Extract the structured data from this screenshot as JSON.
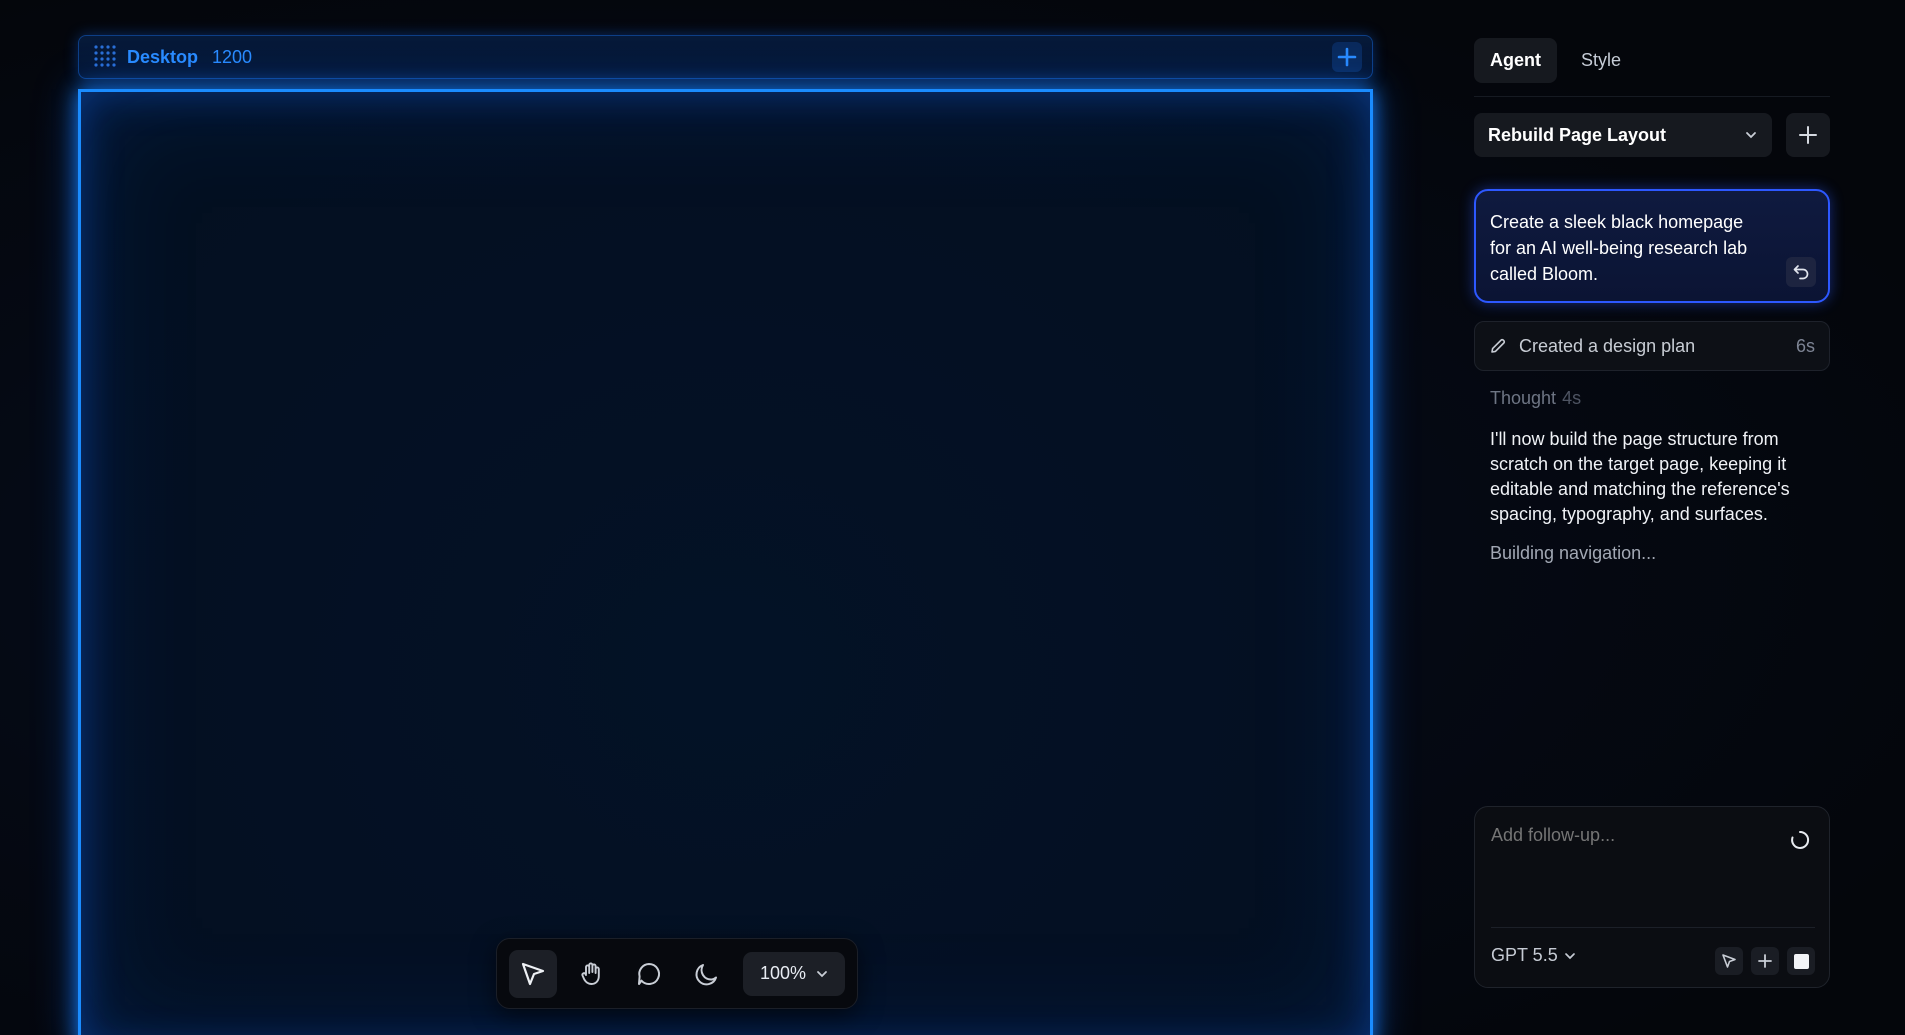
{
  "frame": {
    "name": "Desktop",
    "width_label": "1200",
    "accent": "#1a8cff"
  },
  "toolbar": {
    "tools": [
      "pointer-icon",
      "hand-icon",
      "comment-icon",
      "moon-icon"
    ],
    "active_tool": "pointer-icon",
    "zoom": "100%"
  },
  "panel": {
    "tabs": [
      {
        "label": "Agent",
        "active": true
      },
      {
        "label": "Style",
        "active": false
      }
    ],
    "plan_select": "Rebuild Page Layout",
    "prompt": "Create a sleek black homepage for an AI well-being research lab called Bloom.",
    "step": {
      "label": "Created a design plan",
      "time": "6s"
    },
    "thought": {
      "label": "Thought",
      "time": "4s"
    },
    "thought_text": "I'll now build the page structure from scratch on the target page, keeping it editable and matching the reference's spacing, typography, and surfaces.",
    "status": "Building navigation...",
    "followup": {
      "placeholder": "Add follow-up...",
      "model": "GPT 5.5"
    }
  },
  "colors": {
    "prompt_border": "#2d58ff",
    "panel_bg": "#16191f"
  }
}
